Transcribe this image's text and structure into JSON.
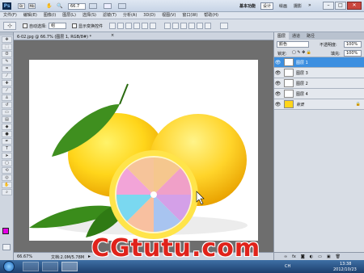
{
  "app": {
    "logo": "Ps",
    "zoom": "66.7",
    "workspaces": [
      "基本功能",
      "设计",
      "绘画",
      "摄影"
    ],
    "more": "»"
  },
  "menu": [
    "文件(F)",
    "编辑(E)",
    "图像(I)",
    "图层(L)",
    "选择(S)",
    "滤镜(T)",
    "分析(A)",
    "3D(D)",
    "视图(V)",
    "窗口(W)",
    "帮助(H)"
  ],
  "options": {
    "auto_select": "自动选择:",
    "auto_select_value": "组",
    "show_transform": "显示变换控件"
  },
  "document": {
    "tab_title": "6-02.jpg @ 66.7% (图层 1, RGB/8#) *",
    "zoom_status": "66.67%",
    "doc_info": "文档:2.0M/5.78M"
  },
  "panel": {
    "tabs": [
      "图层",
      "通道",
      "路径"
    ],
    "blend_mode": "颜色",
    "opacity_label": "不透明度:",
    "opacity_value": "100%",
    "lock_label": "锁定:",
    "fill_label": "填充:",
    "fill_value": "100%",
    "layers": [
      {
        "name": "图层 1",
        "selected": true
      },
      {
        "name": "图层 3",
        "selected": false
      },
      {
        "name": "图层 2",
        "selected": false
      },
      {
        "name": "图层 4",
        "selected": false
      },
      {
        "name": "背景",
        "selected": false
      }
    ]
  },
  "taskbar": {
    "time": "13:38",
    "date": "2012/10/23",
    "lang": "CH"
  },
  "watermark": "CGtutu.com",
  "colors": {
    "accent": "#3c8fe0",
    "watermark": "#e0231b"
  }
}
